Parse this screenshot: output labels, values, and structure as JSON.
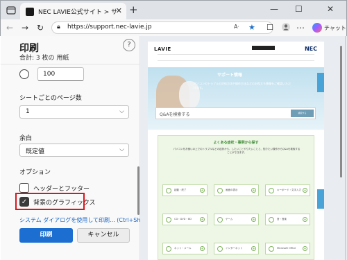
{
  "browser": {
    "tab_title": "NEC LAVIE公式サイト > サービス&サポ",
    "tab_close": "✕",
    "new_tab": "+",
    "window_controls": {
      "minimize": "—",
      "maximize": "☐",
      "close": "✕"
    },
    "url": "https://support.nec-lavie.jp",
    "copilot_label": "チャット"
  },
  "print_panel": {
    "title": "印刷",
    "summary": "合計: 3 枚の 用紙",
    "help": "?",
    "scale_value": "100",
    "pages_per_sheet": {
      "label": "シートごとのページ数",
      "value": "1"
    },
    "margins": {
      "label": "余白",
      "value": "既定値"
    },
    "options_label": "オプション",
    "headers_footers": {
      "label": "ヘッダーとフッター",
      "checked": false
    },
    "background_graphics": {
      "label": "背景のグラフィックス",
      "checked": true
    },
    "system_dialog_link": "システム ダイアログを使用して印刷... (Ctrl+Shift+P)",
    "print_button": "印刷",
    "cancel_button": "キャンセル",
    "colors": {
      "primary": "#1c6fd0",
      "highlight": "#d9161c"
    }
  },
  "preview": {
    "logo_left": "LAVIE",
    "logo_right": "NEC",
    "hero_title": "サポート情報",
    "hero_text": "パソコンのトラブルの対処方法や操作方法などのお役立ち情報をご確認いただけます。",
    "qa_placeholder": "Q&Aを検索する",
    "qa_button": "検索する",
    "faq_title": "よくある症状・事例から探す",
    "faq_desc": "パソコンをお使いの上でのトラブルなどの症状から、したいことやりたいことと、知りたい操作からQ&Aを検索することができます。",
    "faq_cards": [
      "起動・終了",
      "画面の表示",
      "キーボード・文字入力",
      "CD・DVD・BD",
      "ゲーム",
      "音・音楽",
      "ネット・メール",
      "インターネット",
      "Microsoft Office"
    ]
  }
}
